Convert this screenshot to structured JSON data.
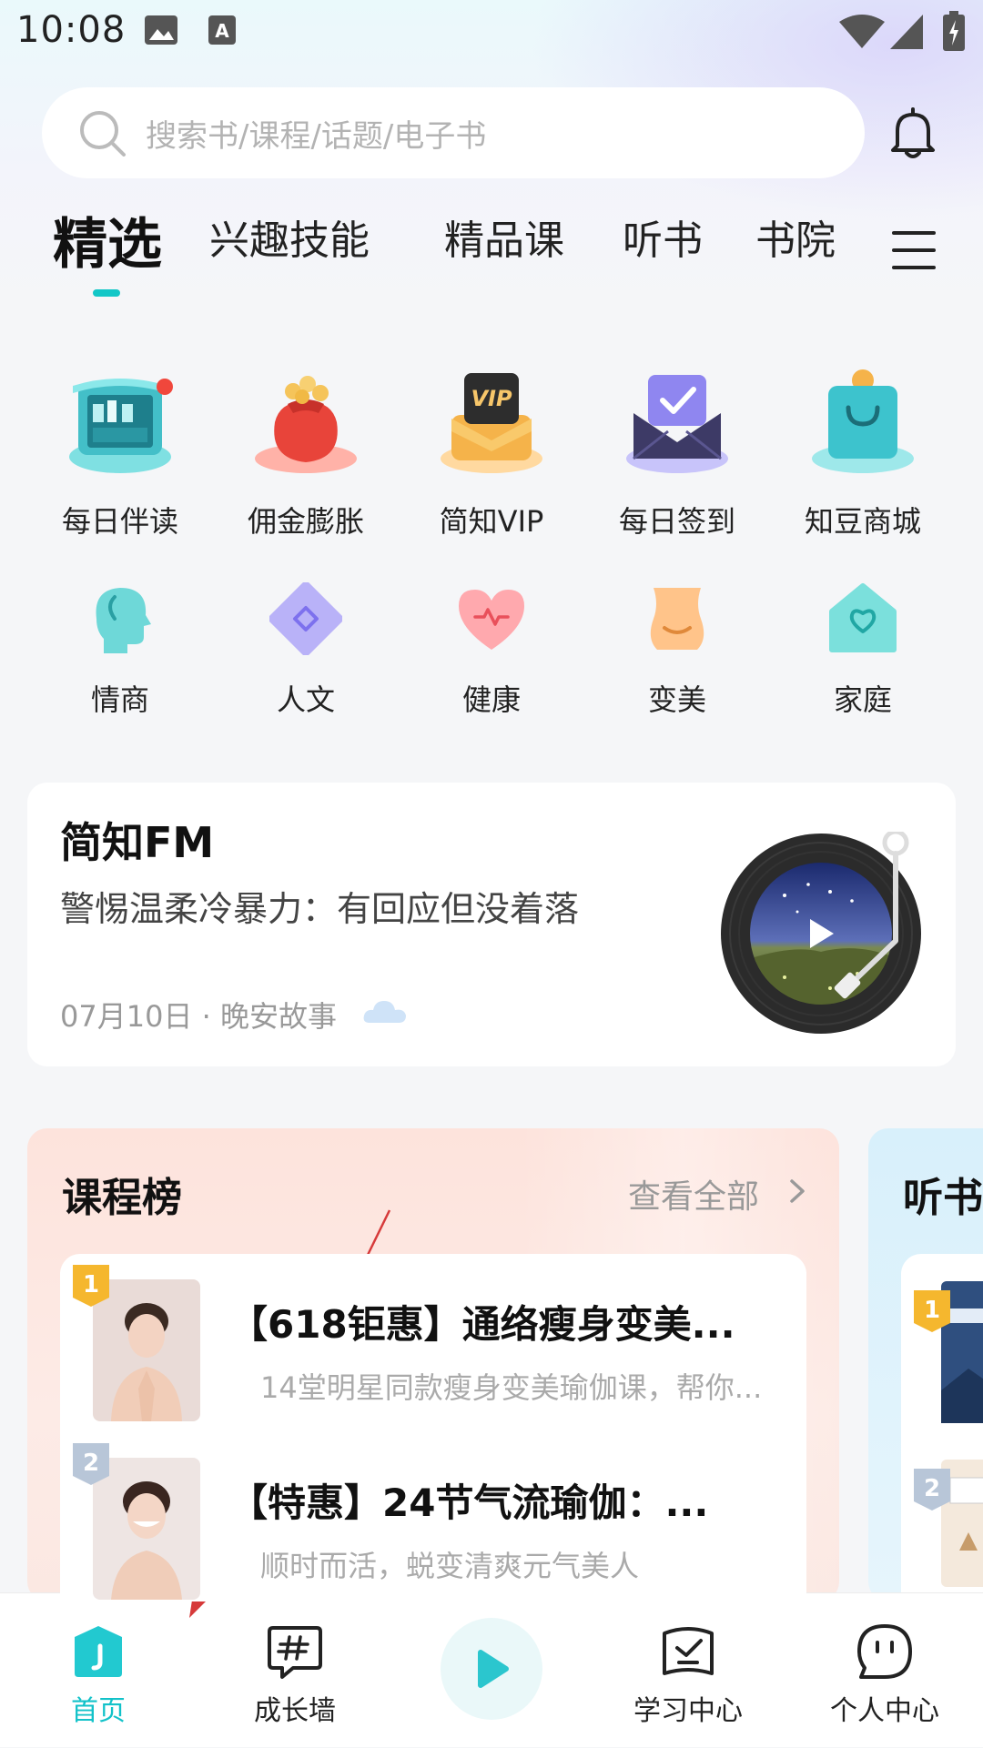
{
  "status_bar": {
    "time": "10:08"
  },
  "search": {
    "placeholder": "搜索书/课程/话题/电子书"
  },
  "tabs": [
    {
      "label": "精选"
    },
    {
      "label": "兴趣技能"
    },
    {
      "label": "精品课"
    },
    {
      "label": "听书"
    },
    {
      "label": "书院"
    }
  ],
  "quick_row1": [
    {
      "label": "每日伴读",
      "icon": "bookshelf-icon"
    },
    {
      "label": "佣金膨胀",
      "icon": "money-bag-icon"
    },
    {
      "label": "简知VIP",
      "icon": "vip-icon",
      "badge": "VIP"
    },
    {
      "label": "每日签到",
      "icon": "checkin-envelope-icon"
    },
    {
      "label": "知豆商城",
      "icon": "shopping-bag-icon"
    }
  ],
  "quick_row2": [
    {
      "label": "情商",
      "icon": "head-icon"
    },
    {
      "label": "人文",
      "icon": "diamond-icon"
    },
    {
      "label": "健康",
      "icon": "heart-icon"
    },
    {
      "label": "变美",
      "icon": "body-icon"
    },
    {
      "label": "家庭",
      "icon": "home-heart-icon"
    }
  ],
  "fm": {
    "title": "简知FM",
    "subtitle": "警惕温柔冷暴力：有回应但没着落",
    "meta": "07月10日 · 晚安故事"
  },
  "course_rank": {
    "title": "课程榜",
    "view_all": "查看全部",
    "items": [
      {
        "rank": "1",
        "title": "【618钜惠】通络瘦身变美...",
        "desc": "14堂明星同款瘦身变美瑜伽课，帮你..."
      },
      {
        "rank": "2",
        "title": "【特惠】24节气流瑜伽：...",
        "desc": "顺时而活，蜕变清爽元气美人"
      }
    ]
  },
  "book_rank": {
    "title": "听书"
  },
  "bottom_nav": [
    {
      "label": "首页",
      "active": true
    },
    {
      "label": "成长墙"
    },
    {
      "label": "学习中心"
    },
    {
      "label": "个人中心"
    }
  ],
  "colors": {
    "accent": "#12c7c7",
    "annotation": "#d63a3a"
  }
}
